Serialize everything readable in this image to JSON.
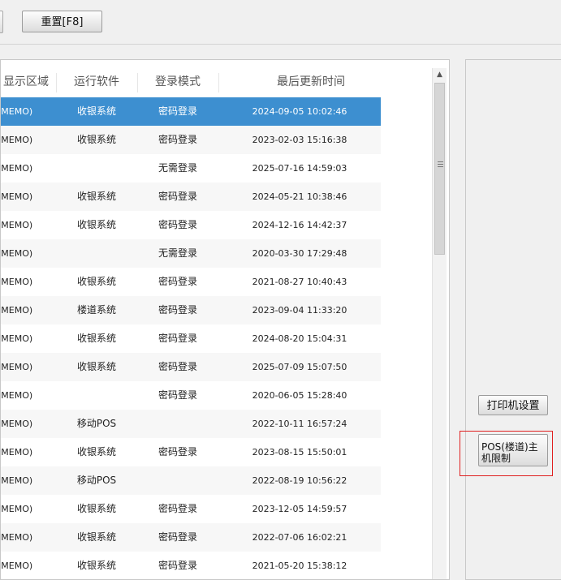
{
  "toolbar": {
    "reset_label": "重置[F8]"
  },
  "grid": {
    "columns": [
      "显示区域",
      "运行软件",
      "登录模式",
      "最后更新时间"
    ],
    "rows": [
      {
        "area": "(MEMO)",
        "software": "收银系统",
        "login": "密码登录",
        "updated": "2024-09-05 10:02:46",
        "selected": true
      },
      {
        "area": "(MEMO)",
        "software": "收银系统",
        "login": "密码登录",
        "updated": "2023-02-03 15:16:38"
      },
      {
        "area": "(MEMO)",
        "software": "",
        "login": "无需登录",
        "updated": "2025-07-16 14:59:03"
      },
      {
        "area": "(MEMO)",
        "software": "收银系统",
        "login": "密码登录",
        "updated": "2024-05-21 10:38:46"
      },
      {
        "area": "(MEMO)",
        "software": "收银系统",
        "login": "密码登录",
        "updated": "2024-12-16 14:42:37"
      },
      {
        "area": "(MEMO)",
        "software": "",
        "login": "无需登录",
        "updated": "2020-03-30 17:29:48"
      },
      {
        "area": "(MEMO)",
        "software": "收银系统",
        "login": "密码登录",
        "updated": "2021-08-27 10:40:43"
      },
      {
        "area": "(MEMO)",
        "software": "楼道系统",
        "login": "密码登录",
        "updated": "2023-09-04 11:33:20"
      },
      {
        "area": "(MEMO)",
        "software": "收银系统",
        "login": "密码登录",
        "updated": "2024-08-20 15:04:31"
      },
      {
        "area": "(MEMO)",
        "software": "收银系统",
        "login": "密码登录",
        "updated": "2025-07-09 15:07:50"
      },
      {
        "area": "(MEMO)",
        "software": "",
        "login": "密码登录",
        "updated": "2020-06-05 15:28:40"
      },
      {
        "area": "(MEMO)",
        "software": "移动POS",
        "login": "",
        "updated": "2022-10-11 16:57:24"
      },
      {
        "area": "(MEMO)",
        "software": "收银系统",
        "login": "密码登录",
        "updated": "2023-08-15 15:50:01"
      },
      {
        "area": "(MEMO)",
        "software": "移动POS",
        "login": "",
        "updated": "2022-08-19 10:56:22"
      },
      {
        "area": "(MEMO)",
        "software": "收银系统",
        "login": "密码登录",
        "updated": "2023-12-05 14:59:57"
      },
      {
        "area": "(MEMO)",
        "software": "收银系统",
        "login": "密码登录",
        "updated": "2022-07-06 16:02:21"
      },
      {
        "area": "(MEMO)",
        "software": "收银系统",
        "login": "密码登录",
        "updated": "2021-05-20 15:38:12"
      }
    ]
  },
  "side": {
    "print_settings_label": "打印机设置",
    "pos_limit_label": "POS(楼道)主机限制"
  },
  "icons": {
    "scroll_up": "▲"
  },
  "colors": {
    "selected_row": "#3d8fd0",
    "highlight_box": "#e02020"
  }
}
